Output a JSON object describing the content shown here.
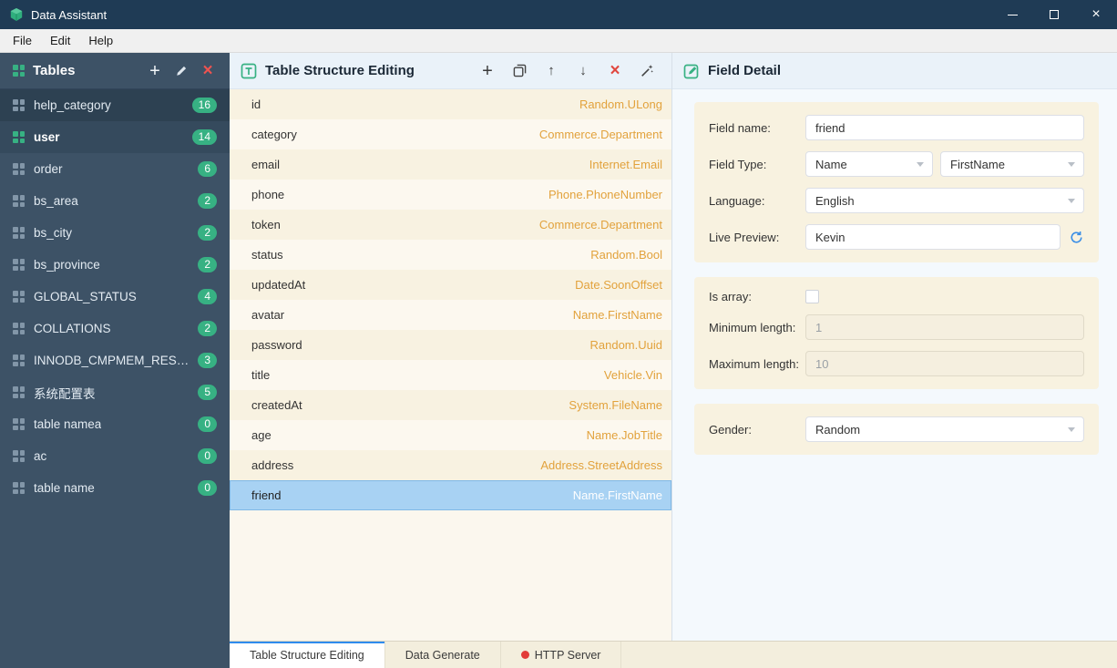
{
  "titlebar": {
    "app_title": "Data Assistant"
  },
  "menubar": {
    "items": [
      "File",
      "Edit",
      "Help"
    ]
  },
  "icons": {
    "add_glyph": "+",
    "move_up_glyph": "↑",
    "move_down_glyph": "↓",
    "delete_glyph": "×",
    "close_glyph": "×"
  },
  "colors": {
    "accent_green": "#37b183",
    "type_orange": "#e2a23c",
    "selection_blue": "#a8d2f3",
    "titlebar_navy": "#1f3b55",
    "danger_red": "#e0473f"
  },
  "sidebar": {
    "title": "Tables",
    "items": [
      {
        "label": "help_category",
        "count": "16",
        "state": "dim"
      },
      {
        "label": "user",
        "count": "14",
        "state": "selected"
      },
      {
        "label": "order",
        "count": "6"
      },
      {
        "label": "bs_area",
        "count": "2"
      },
      {
        "label": "bs_city",
        "count": "2"
      },
      {
        "label": "bs_province",
        "count": "2"
      },
      {
        "label": "GLOBAL_STATUS",
        "count": "4"
      },
      {
        "label": "COLLATIONS",
        "count": "2"
      },
      {
        "label": "INNODB_CMPMEM_RESET",
        "count": "3"
      },
      {
        "label": "系统配置表",
        "count": "5"
      },
      {
        "label": "table namea",
        "count": "0"
      },
      {
        "label": "ac",
        "count": "0"
      },
      {
        "label": "table name",
        "count": "0"
      }
    ]
  },
  "structure_panel": {
    "title": "Table Structure Editing",
    "fields": [
      {
        "name": "id",
        "type": "Random.ULong"
      },
      {
        "name": "category",
        "type": "Commerce.Department"
      },
      {
        "name": "email",
        "type": "Internet.Email"
      },
      {
        "name": "phone",
        "type": "Phone.PhoneNumber"
      },
      {
        "name": "token",
        "type": "Commerce.Department"
      },
      {
        "name": "status",
        "type": "Random.Bool"
      },
      {
        "name": "updatedAt",
        "type": "Date.SoonOffset"
      },
      {
        "name": "avatar",
        "type": "Name.FirstName"
      },
      {
        "name": "password",
        "type": "Random.Uuid"
      },
      {
        "name": "title",
        "type": "Vehicle.Vin"
      },
      {
        "name": "createdAt",
        "type": "System.FileName"
      },
      {
        "name": "age",
        "type": "Name.JobTitle"
      },
      {
        "name": "address",
        "type": "Address.StreetAddress"
      },
      {
        "name": "friend",
        "type": "Name.FirstName",
        "selected": true
      }
    ]
  },
  "detail_panel": {
    "title": "Field Detail",
    "field_name_label": "Field name:",
    "field_name_value": "friend",
    "field_type_label": "Field Type:",
    "field_type_value": "Name",
    "field_subtype_value": "FirstName",
    "language_label": "Language:",
    "language_value": "English",
    "live_preview_label": "Live Preview:",
    "live_preview_value": "Kevin",
    "is_array_label": "Is array:",
    "min_length_label": "Minimum length:",
    "min_length_value": "1",
    "max_length_label": "Maximum length:",
    "max_length_value": "10",
    "gender_label": "Gender:",
    "gender_value": "Random"
  },
  "bottom_tabs": {
    "items": [
      {
        "label": "Table Structure Editing",
        "active": true
      },
      {
        "label": "Data Generate"
      },
      {
        "label": "HTTP Server",
        "dot": true
      }
    ]
  }
}
